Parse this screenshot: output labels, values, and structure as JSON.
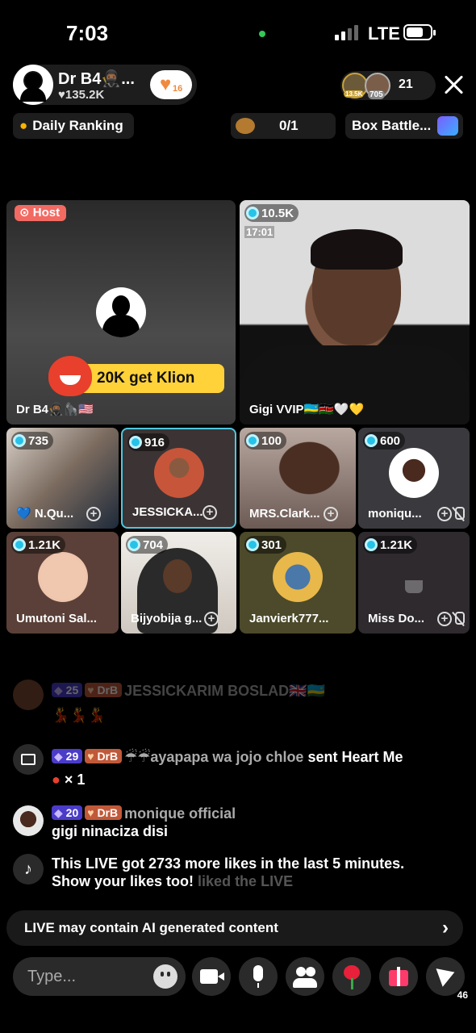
{
  "status": {
    "time": "7:03",
    "network": "LTE"
  },
  "host": {
    "name": "Dr B4🥷🏾...",
    "likes": "♥135.2K",
    "fan_level": "16"
  },
  "viewers": {
    "badge1": "13.5K",
    "badge2": "705",
    "count": "21"
  },
  "pills": {
    "ranking": "Daily Ranking",
    "goal": "0/1",
    "box": "Box Battle..."
  },
  "guests": {
    "host_tile": {
      "tag": "Host",
      "promo": "20K get Klion",
      "name": "Dr B4🥷🏾🦍🇺🇸"
    },
    "main": {
      "count": "10.5K",
      "timer": "17:01",
      "name": "Gigi VVIP🇷🇼🇰🇪🤍💛"
    },
    "grid": [
      {
        "count": "735",
        "name": "💙 N.Qu..."
      },
      {
        "count": "916",
        "name": "JESSICKA..."
      },
      {
        "count": "100",
        "name": "MRS.Clark..."
      },
      {
        "count": "600",
        "name": "moniqu..."
      },
      {
        "count": "1.21K",
        "name": "Umutoni Sal..."
      },
      {
        "count": "704",
        "name": "Bijyobija g..."
      },
      {
        "count": "301",
        "name": "Janvierk777..."
      },
      {
        "count": "1.21K",
        "name": "Miss Do..."
      }
    ]
  },
  "chat": [
    {
      "level": "25",
      "fan": "DrB",
      "user": "JESSICKARIM BOSLAD🇬🇧🇷🇼",
      "text": "💃💃💃"
    },
    {
      "level": "29",
      "fan": "DrB",
      "user": "☔☔ayapapa wa jojo chloe",
      "action": "sent Heart Me",
      "qty": "× 1"
    },
    {
      "level": "20",
      "fan": "DrB",
      "user": "monique official",
      "text": "gigi ninaciza disi"
    },
    {
      "line1": "This LIVE got 2733 more likes in the last 5 minutes.",
      "line2": "Show your likes too!",
      "faded": "liked the LIVE"
    }
  ],
  "notice": "LIVE may contain AI generated content",
  "composer": {
    "placeholder": "Type..."
  },
  "share_count": "46"
}
